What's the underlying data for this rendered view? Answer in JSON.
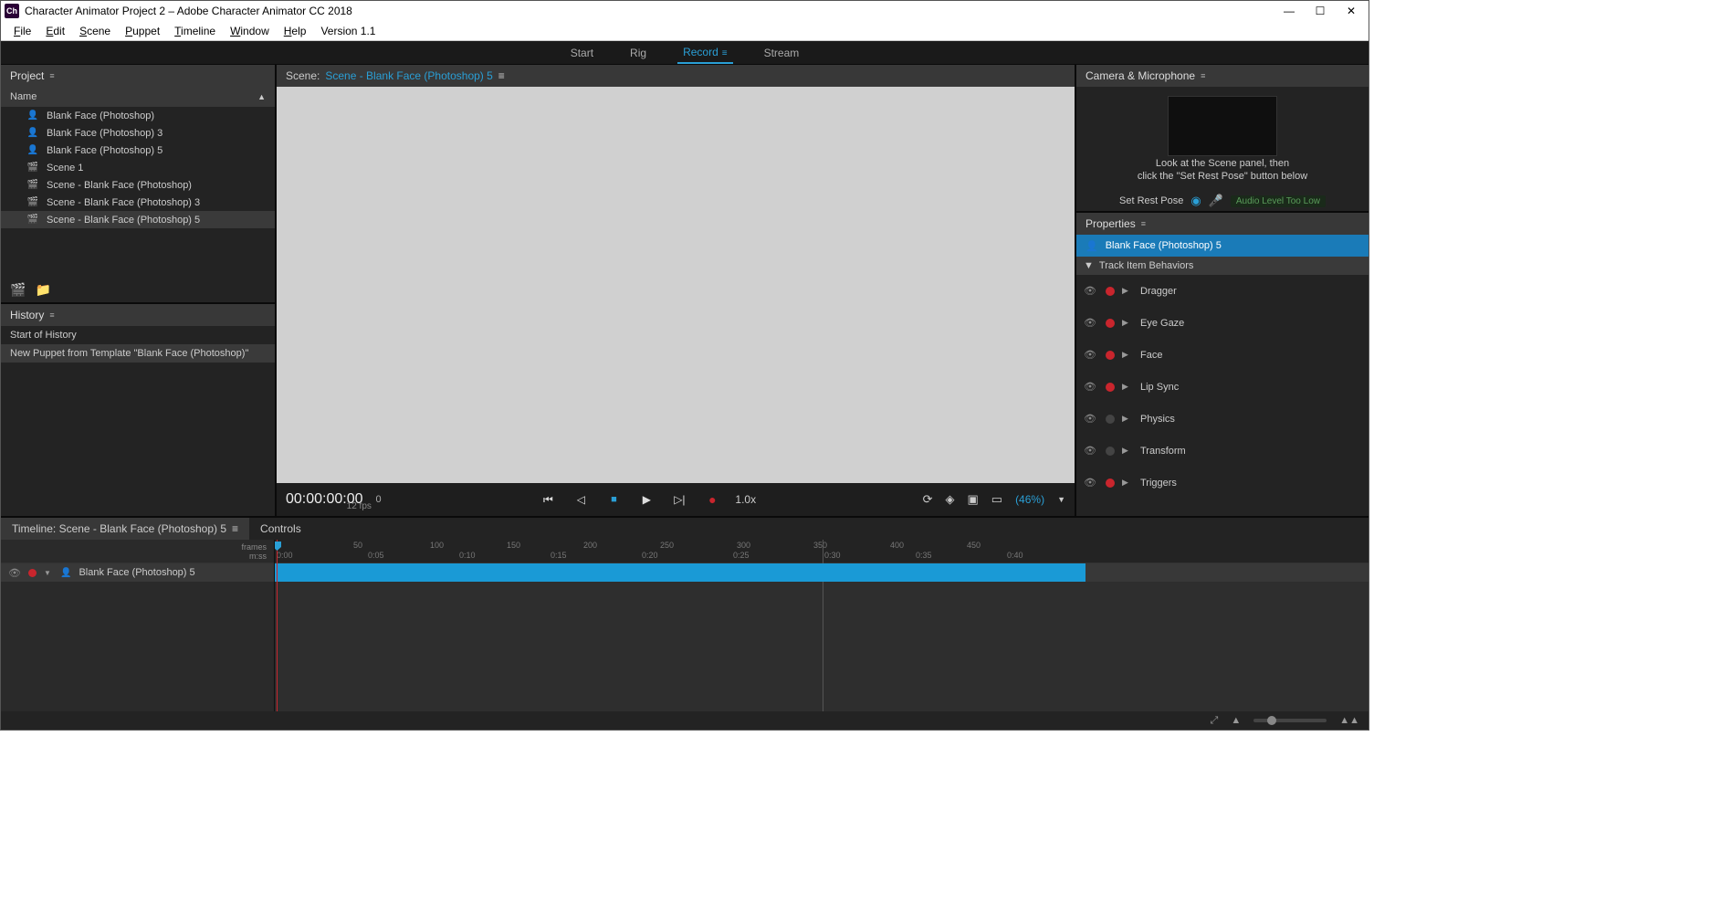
{
  "window": {
    "app_icon_text": "Ch",
    "title": "Character Animator Project 2 – Adobe Character Animator CC 2018"
  },
  "menu": [
    "File",
    "Edit",
    "Scene",
    "Puppet",
    "Timeline",
    "Window",
    "Help",
    "Version 1.1"
  ],
  "workspace_tabs": {
    "items": [
      "Start",
      "Rig",
      "Record",
      "Stream"
    ],
    "active_index": 2
  },
  "project": {
    "title": "Project",
    "column": "Name",
    "items": [
      {
        "icon": "puppet",
        "label": "Blank Face (Photoshop)"
      },
      {
        "icon": "puppet",
        "label": "Blank Face (Photoshop) 3"
      },
      {
        "icon": "puppet",
        "label": "Blank Face (Photoshop) 5"
      },
      {
        "icon": "scene",
        "label": "Scene 1"
      },
      {
        "icon": "scene",
        "label": "Scene - Blank Face (Photoshop)"
      },
      {
        "icon": "scene",
        "label": "Scene - Blank Face (Photoshop) 3"
      },
      {
        "icon": "scene",
        "label": "Scene - Blank Face (Photoshop) 5",
        "selected": true
      }
    ]
  },
  "history": {
    "title": "History",
    "items": [
      {
        "label": "Start of History"
      },
      {
        "label": "New Puppet from Template \"Blank Face (Photoshop)\"",
        "selected": true
      }
    ]
  },
  "scene": {
    "prefix": "Scene:",
    "name": "Scene - Blank Face (Photoshop) 5"
  },
  "transport": {
    "timecode": "00:00:00:00",
    "frame": "0",
    "fps": "12 fps",
    "speed": "1.0x",
    "zoom": "(46%)"
  },
  "camera": {
    "title": "Camera & Microphone",
    "hint1": "Look at the Scene panel, then",
    "hint2": "click the \"Set Rest Pose\" button below",
    "set_rest": "Set Rest Pose",
    "audio_status": "Audio Level Too Low"
  },
  "properties": {
    "title": "Properties",
    "selected": "Blank Face (Photoshop) 5",
    "section": "Track Item Behaviors",
    "behaviors": [
      {
        "name": "Dragger",
        "armed": true
      },
      {
        "name": "Eye Gaze",
        "armed": true
      },
      {
        "name": "Face",
        "armed": true
      },
      {
        "name": "Lip Sync",
        "armed": true
      },
      {
        "name": "Physics",
        "armed": false
      },
      {
        "name": "Transform",
        "armed": false
      },
      {
        "name": "Triggers",
        "armed": true
      }
    ]
  },
  "timeline": {
    "tab_label": "Timeline: Scene - Blank Face (Photoshop) 5",
    "controls_tab": "Controls",
    "ruler_frames_label": "frames",
    "ruler_time_label": "m:ss",
    "frames_ticks": [
      "0",
      "50",
      "100",
      "150",
      "200",
      "250",
      "300",
      "350",
      "400",
      "450"
    ],
    "time_ticks": [
      "0:00",
      "0:05",
      "0:10",
      "0:15",
      "0:20",
      "0:25",
      "0:30",
      "0:35",
      "0:40"
    ],
    "track_name": "Blank Face (Photoshop) 5"
  }
}
